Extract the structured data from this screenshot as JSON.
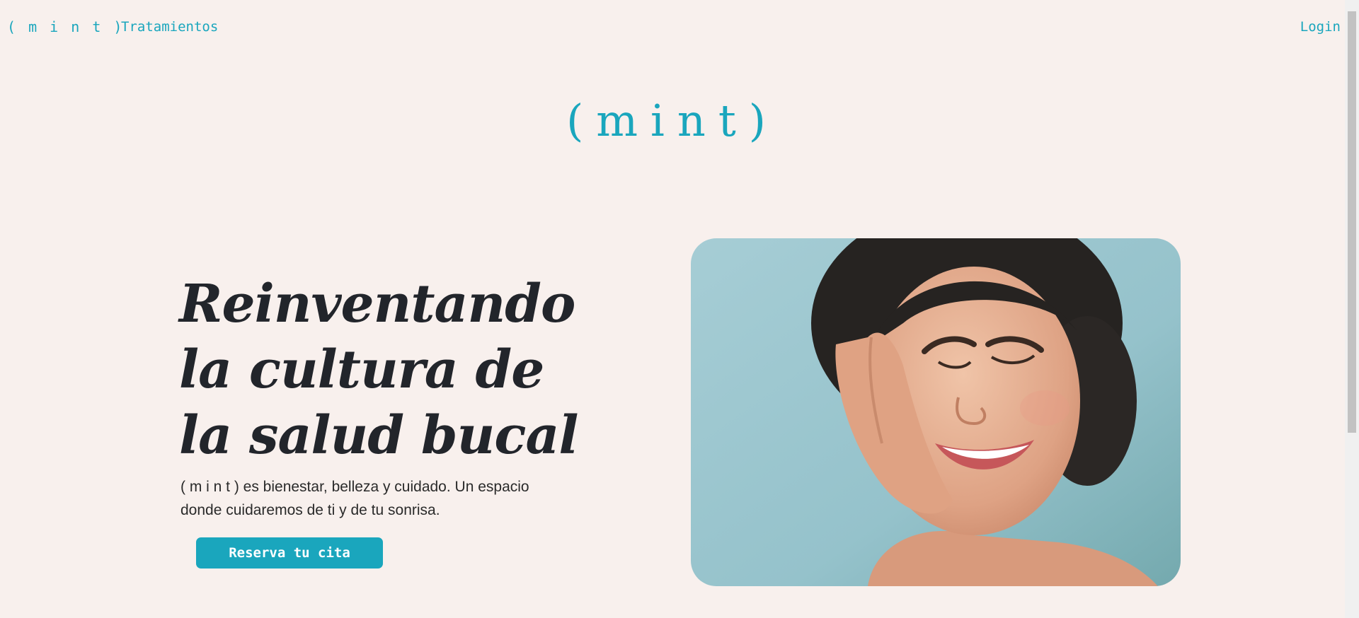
{
  "nav": {
    "brand": "( m i n t )",
    "treatments": "Tratamientos",
    "login": "Login"
  },
  "logo": "(mint)",
  "hero": {
    "title_lines": [
      "Reinventando",
      "la cultura de",
      "la salud bucal"
    ],
    "description": "( m i n t ) es bienestar, belleza y cuidado. Un espacio donde cuidaremos de ti y de tu sonrisa.",
    "cta": "Reserva tu cita"
  },
  "colors": {
    "background": "#f8f0ed",
    "accent": "#1aa6bd",
    "heading": "#22252b"
  }
}
